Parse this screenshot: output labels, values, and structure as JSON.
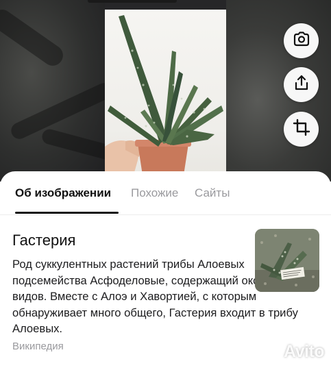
{
  "viewer": {
    "actions": [
      {
        "name": "camera-search-button",
        "icon": "camera-search-icon"
      },
      {
        "name": "share-button",
        "icon": "share-icon"
      },
      {
        "name": "crop-button",
        "icon": "crop-icon"
      }
    ]
  },
  "tabs": [
    {
      "label": "Об изображении",
      "active": true
    },
    {
      "label": "Похожие",
      "active": false
    },
    {
      "label": "Сайты",
      "active": false
    }
  ],
  "card": {
    "title": "Гастерия",
    "text": "Род суккулентных растений трибы Алоевых подсемейства Асфоделовые, содержащий около 26 видов. Вместе с Алоэ и Хавортией, с которым обнаруживает много общего, Гастерия входит в трибу Алоевых.",
    "source": "Википедия"
  },
  "watermark": {
    "text": "Avito",
    "icon": "avito-logo-icon"
  }
}
